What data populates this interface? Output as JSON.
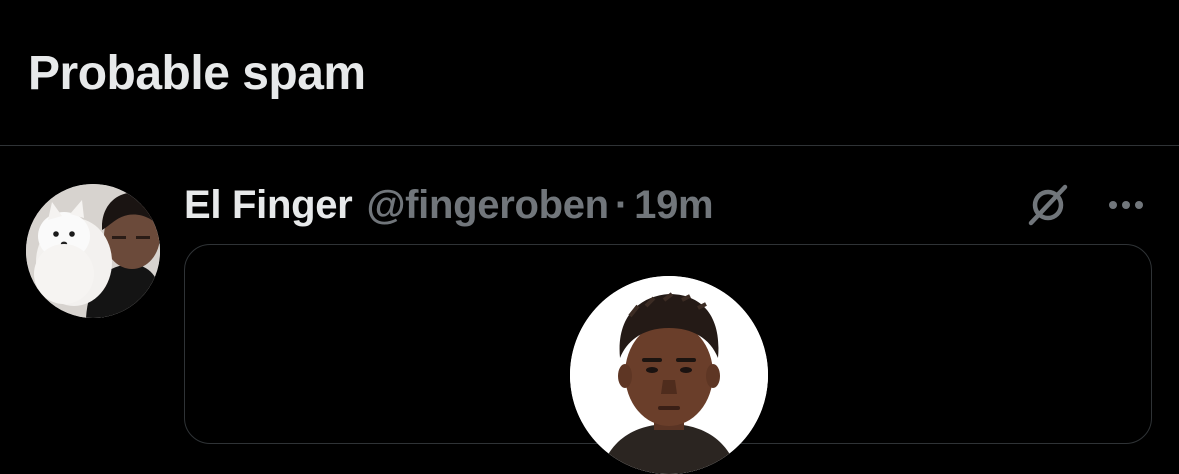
{
  "section": {
    "title": "Probable spam"
  },
  "post": {
    "author": {
      "display_name": "El Finger",
      "handle": "@fingeroben",
      "separator": "·",
      "time": "19m"
    },
    "icons": {
      "grok": "grok-icon",
      "more": "more-options-icon"
    }
  },
  "colors": {
    "background": "#000000",
    "primary_text": "#e7e9ea",
    "secondary_text": "#71767b",
    "divider": "#2f3336"
  }
}
